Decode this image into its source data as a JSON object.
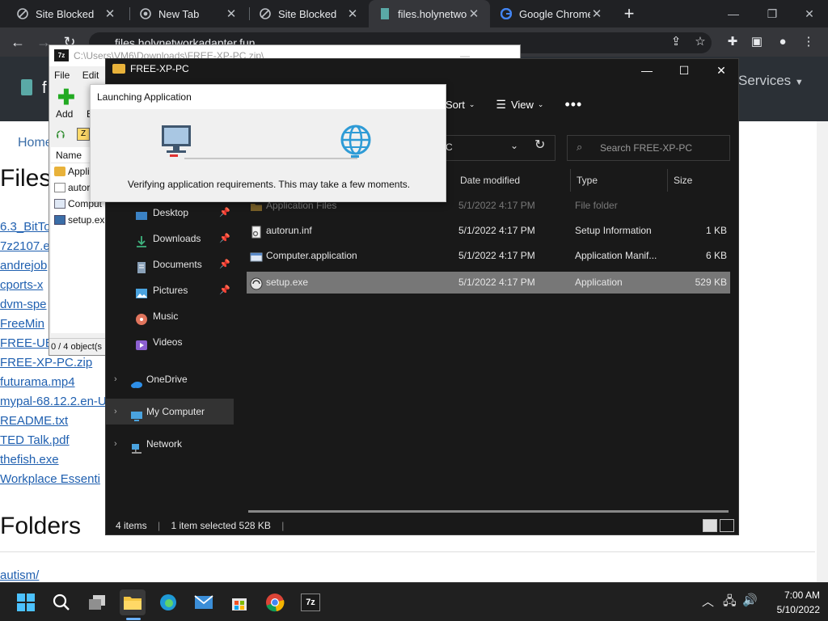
{
  "browser": {
    "tabs": [
      {
        "label": "Site Blocked",
        "favicon": "blocked-icon"
      },
      {
        "label": "New Tab",
        "favicon": "chrome-icon"
      },
      {
        "label": "Site Blocked",
        "favicon": "blocked-icon"
      },
      {
        "label": "files.holynetwo",
        "favicon": "bookmark-icon"
      },
      {
        "label": "Google Chrome",
        "favicon": "google-icon"
      }
    ],
    "new_tab": "+",
    "address": "files.holynetworkadapter.fun"
  },
  "webpage": {
    "logo_text": "f",
    "services_label": "Services",
    "breadcrumb_home": "Home",
    "files_heading": "Files",
    "file_links": [
      "6.3_BitTo",
      "7z2107.e",
      "andrejob",
      "cports-x",
      "dvm-spe",
      "FreeMin",
      "FREE-UB",
      "FREE-XP-PC.zip",
      "futurama.mp4",
      "mypal-68.12.2.en-U",
      "README.txt",
      "TED Talk.pdf",
      "thefish.exe",
      "Workplace Essenti"
    ],
    "folders_heading": "Folders",
    "folder_links": [
      "autism/"
    ]
  },
  "zip_window": {
    "title": "C:\\Users\\VM6\\Downloads\\FREE-XP-PC.zip\\",
    "badge": "7z",
    "menu": [
      "File",
      "Edit"
    ],
    "add_label": "Add",
    "extract_label_partial": "E",
    "column_name": "Name",
    "rows": [
      "Appli",
      "autor",
      "Comput",
      "setup.exe"
    ],
    "status": "0 / 4 object(s"
  },
  "explorer": {
    "title": "FREE-XP-PC",
    "commands": {
      "sort": "Sort",
      "view": "View",
      "more": "•••"
    },
    "address_tail": "C",
    "search_placeholder": "Search FREE-XP-PC",
    "columns": {
      "date": "Date modified",
      "type": "Type",
      "size": "Size"
    },
    "files": [
      {
        "name": "Application Files",
        "date": "5/1/2022 4:17 PM",
        "type": "File folder",
        "size": "",
        "icon": "folder-icon"
      },
      {
        "name": "autorun.inf",
        "date": "5/1/2022 4:17 PM",
        "type": "Setup Information",
        "size": "1 KB",
        "icon": "settings-file-icon"
      },
      {
        "name": "Computer.application",
        "date": "5/1/2022 4:17 PM",
        "type": "Application Manif...",
        "size": "6 KB",
        "icon": "application-file-icon"
      },
      {
        "name": "setup.exe",
        "date": "5/1/2022 4:17 PM",
        "type": "Application",
        "size": "529 KB",
        "icon": "exe-icon"
      }
    ],
    "nav_quick": [
      {
        "label": "Desktop",
        "icon": "desktop-icon",
        "color": "#3b82c4"
      },
      {
        "label": "Downloads",
        "icon": "download-icon",
        "color": "#3fb37f"
      },
      {
        "label": "Documents",
        "icon": "documents-icon",
        "color": "#8aa1b8"
      },
      {
        "label": "Pictures",
        "icon": "pictures-icon",
        "color": "#4aa3df"
      },
      {
        "label": "Music",
        "icon": "music-icon",
        "color": "#e0745c"
      },
      {
        "label": "Videos",
        "icon": "videos-icon",
        "color": "#8c5fd0"
      }
    ],
    "nav_roots": [
      {
        "label": "OneDrive",
        "icon": "onedrive-icon"
      },
      {
        "label": "My Computer",
        "icon": "computer-icon"
      },
      {
        "label": "Network",
        "icon": "network-icon"
      }
    ],
    "status": {
      "items": "4 items",
      "selected": "1 item selected  528 KB"
    }
  },
  "dialog": {
    "title": "Launching Application",
    "message": "Verifying application requirements. This may take a few moments."
  },
  "taskbar": {
    "time": "7:00 AM",
    "date": "5/10/2022",
    "pinned": [
      "start",
      "search",
      "task-view",
      "file-explorer",
      "edge",
      "mail",
      "store",
      "chrome",
      "7zip"
    ]
  }
}
